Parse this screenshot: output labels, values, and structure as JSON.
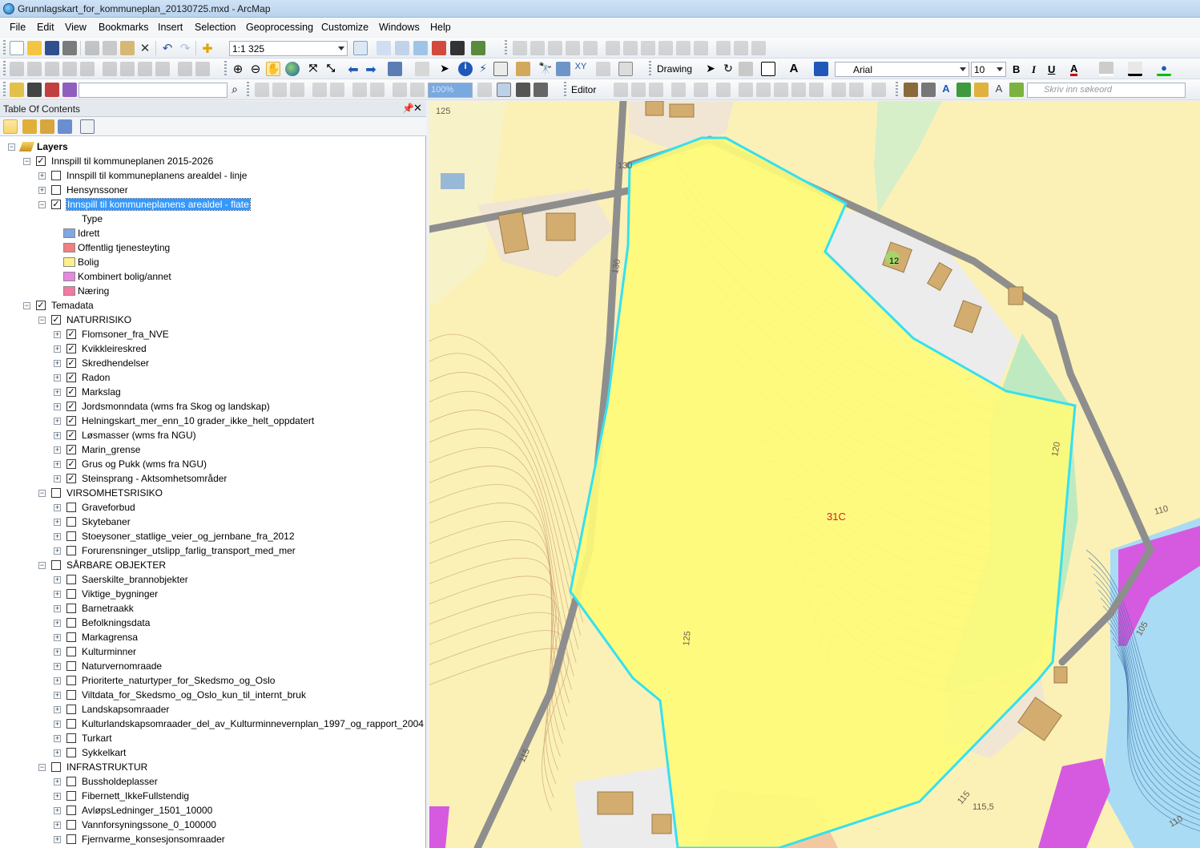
{
  "window": {
    "title": "Grunnlagskart_for_kommuneplan_20130725.mxd - ArcMap"
  },
  "menu": [
    "File",
    "Edit",
    "View",
    "Bookmarks",
    "Insert",
    "Selection",
    "Geoprocessing",
    "Customize",
    "Windows",
    "Help"
  ],
  "toolbar": {
    "scale": "1:1 325",
    "drawing_label": "Drawing",
    "font_name": "Arial",
    "font_size": "10",
    "bold_label": "B",
    "italic_label": "I",
    "underline_label": "U",
    "font_color_label": "A",
    "editor_label": "Editor",
    "zoom_percent": "100%",
    "search_placeholder": "Skriv inn søkeord"
  },
  "toc": {
    "title": "Table Of Contents",
    "rows": [
      {
        "text": "Layers",
        "bold": true,
        "level": 0,
        "icon": "layers-icon",
        "expander": "−"
      },
      {
        "text": "Innspill til kommuneplanen 2015-2026",
        "level": 1,
        "check": true,
        "expander": "−"
      },
      {
        "text": "Innspill til kommuneplanens arealdel - linje",
        "level": 2,
        "check": false,
        "expander": "+"
      },
      {
        "text": "Hensynssoner",
        "level": 2,
        "check": false,
        "expander": "+"
      },
      {
        "text": "Innspill til kommuneplanens arealdel - flate",
        "level": 2,
        "check": true,
        "expander": "−",
        "selected": true
      },
      {
        "text": "Type",
        "level": 3,
        "legend_header": true
      },
      {
        "text": "Idrett",
        "level": 3,
        "swatch": "#7fa7e0"
      },
      {
        "text": "Offentlig tjenesteyting",
        "level": 3,
        "swatch": "#f08080"
      },
      {
        "text": "Bolig",
        "level": 3,
        "swatch": "#fdf08a"
      },
      {
        "text": "Kombinert bolig/annet",
        "level": 3,
        "swatch": "#e787e0"
      },
      {
        "text": "Næring",
        "level": 3,
        "swatch": "#f07aa0"
      },
      {
        "text": "Temadata",
        "level": 1,
        "check": true,
        "expander": "−"
      },
      {
        "text": "NATURRISIKO",
        "level": 2,
        "check": true,
        "expander": "−"
      },
      {
        "text": "Flomsoner_fra_NVE",
        "level": 3,
        "check": true,
        "expander": "+"
      },
      {
        "text": "Kvikkleireskred",
        "level": 3,
        "check": true,
        "expander": "+"
      },
      {
        "text": "Skredhendelser",
        "level": 3,
        "check": true,
        "expander": "+"
      },
      {
        "text": "Radon",
        "level": 3,
        "check": true,
        "expander": "+"
      },
      {
        "text": "Markslag",
        "level": 3,
        "check": true,
        "expander": "+"
      },
      {
        "text": "Jordsmonndata (wms fra Skog og landskap)",
        "level": 3,
        "check": true,
        "expander": "+"
      },
      {
        "text": "Helningskart_mer_enn_10 grader_ikke_helt_oppdatert",
        "level": 3,
        "check": true,
        "expander": "+"
      },
      {
        "text": "Løsmasser (wms fra NGU)",
        "level": 3,
        "check": true,
        "expander": "+"
      },
      {
        "text": "Marin_grense",
        "level": 3,
        "check": true,
        "expander": "+"
      },
      {
        "text": "Grus og Pukk (wms fra NGU)",
        "level": 3,
        "check": true,
        "expander": "+"
      },
      {
        "text": "Steinsprang - Aktsomhetsområder",
        "level": 3,
        "check": true,
        "expander": "+"
      },
      {
        "text": "VIRSOMHETSRISIKO",
        "level": 2,
        "check": false,
        "expander": "−"
      },
      {
        "text": "Graveforbud",
        "level": 3,
        "check": false,
        "expander": "+"
      },
      {
        "text": "Skytebaner",
        "level": 3,
        "check": false,
        "expander": "+"
      },
      {
        "text": "Stoeysoner_statlige_veier_og_jernbane_fra_2012",
        "level": 3,
        "check": false,
        "expander": "+"
      },
      {
        "text": "Forurensninger_utslipp_farlig_transport_med_mer",
        "level": 3,
        "check": false,
        "expander": "+"
      },
      {
        "text": "SÅRBARE OBJEKTER",
        "level": 2,
        "check": false,
        "expander": "−"
      },
      {
        "text": "Saerskilte_brannobjekter",
        "level": 3,
        "check": false,
        "expander": "+"
      },
      {
        "text": "Viktige_bygninger",
        "level": 3,
        "check": false,
        "expander": "+"
      },
      {
        "text": "Barnetraakk",
        "level": 3,
        "check": false,
        "expander": "+"
      },
      {
        "text": "Befolkningsdata",
        "level": 3,
        "check": false,
        "expander": "+"
      },
      {
        "text": "Markagrensa",
        "level": 3,
        "check": false,
        "expander": "+"
      },
      {
        "text": "Kulturminner",
        "level": 3,
        "check": false,
        "expander": "+"
      },
      {
        "text": "Naturvernomraade",
        "level": 3,
        "check": false,
        "expander": "+"
      },
      {
        "text": "Prioriterte_naturtyper_for_Skedsmo_og_Oslo",
        "level": 3,
        "check": false,
        "expander": "+"
      },
      {
        "text": "Viltdata_for_Skedsmo_og_Oslo_kun_til_internt_bruk",
        "level": 3,
        "check": false,
        "expander": "+"
      },
      {
        "text": "Landskapsomraader",
        "level": 3,
        "check": false,
        "expander": "+"
      },
      {
        "text": "Kulturlandskapsomraader_del_av_Kulturminnevernplan_1997_og_rapport_2004",
        "level": 3,
        "check": false,
        "expander": "+"
      },
      {
        "text": "Turkart",
        "level": 3,
        "check": false,
        "expander": "+"
      },
      {
        "text": "Sykkelkart",
        "level": 3,
        "check": false,
        "expander": "+"
      },
      {
        "text": "INFRASTRUKTUR",
        "level": 2,
        "check": false,
        "expander": "−"
      },
      {
        "text": "Bussholdeplasser",
        "level": 3,
        "check": false,
        "expander": "+"
      },
      {
        "text": "Fibernett_IkkeFullstendig",
        "level": 3,
        "check": false,
        "expander": "+"
      },
      {
        "text": "AvløpsLedninger_1501_10000",
        "level": 3,
        "check": false,
        "expander": "+"
      },
      {
        "text": "Vannforsyningssone_0_100000",
        "level": 3,
        "check": false,
        "expander": "+"
      },
      {
        "text": "Fjernvarme_konsesjonsomraader",
        "level": 3,
        "check": false,
        "expander": "+"
      }
    ]
  },
  "map": {
    "parcel_label": "31C",
    "house_number": "12",
    "contour_labels": [
      "125",
      "130",
      "130",
      "125",
      "120",
      "115",
      "110",
      "105",
      "115",
      "115,5",
      "110"
    ],
    "colors": {
      "base": "#fbf1b6",
      "parcel_fill": "#fdfb7a",
      "parcel_outline": "#35e0f0",
      "road": "#8e8e8e",
      "building": "#d3ac6f",
      "water": "#a9dcf4",
      "purple": "#d65ae0",
      "green": "#bfeac1",
      "contour": "#c99b74"
    }
  }
}
